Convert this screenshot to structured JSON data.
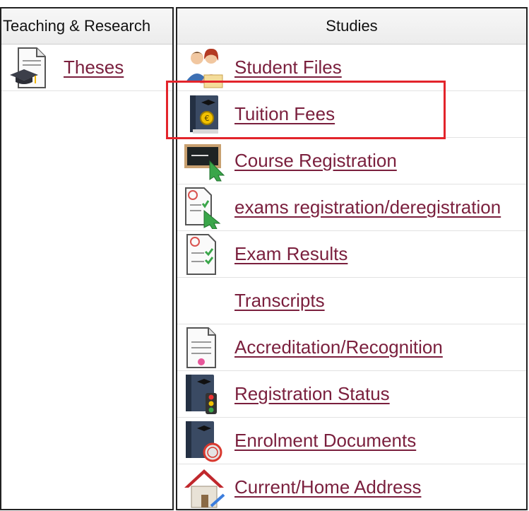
{
  "left_panel": {
    "header": "Teaching & Research",
    "items": [
      {
        "label": "Theses",
        "icon": "thesis-document-icon"
      }
    ]
  },
  "right_panel": {
    "header": "Studies",
    "items": [
      {
        "label": "Student Files",
        "icon": "students-icon"
      },
      {
        "label": "Tuition Fees",
        "icon": "tuition-fees-icon"
      },
      {
        "label": "Course Registration",
        "icon": "course-registration-icon"
      },
      {
        "label": "exams registration/deregistration",
        "icon": "exam-registration-icon"
      },
      {
        "label": "Exam Results",
        "icon": "exam-results-icon"
      },
      {
        "label": "Transcripts",
        "icon": ""
      },
      {
        "label": "Accreditation/Recognition",
        "icon": "accreditation-icon"
      },
      {
        "label": "Registration Status",
        "icon": "registration-status-icon"
      },
      {
        "label": "Enrolment Documents",
        "icon": "enrolment-documents-icon"
      },
      {
        "label": "Current/Home Address",
        "icon": "home-address-icon"
      }
    ]
  },
  "highlight": {
    "target": "Tuition Fees",
    "color": "#e3242b"
  },
  "colors": {
    "link": "#7a1f3d",
    "border": "#222222"
  }
}
